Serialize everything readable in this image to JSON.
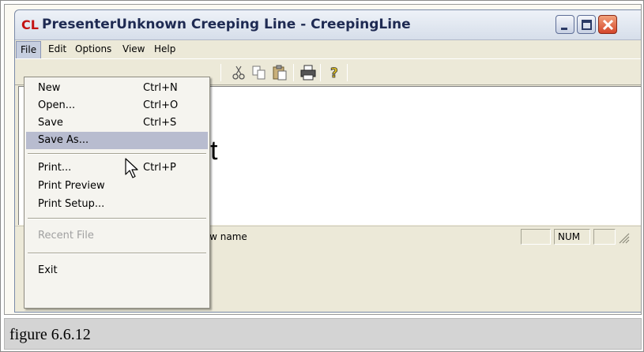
{
  "window": {
    "icon_text": "CL",
    "title": "PresenterUnknown Creeping Line - CreepingLine",
    "controls": {
      "minimize": "minimize",
      "maximize": "maximize",
      "close": "close"
    }
  },
  "menubar": {
    "items": [
      "File",
      "Edit",
      "Options",
      "View",
      "Help"
    ],
    "active": "File"
  },
  "toolbar": {
    "icons": [
      "cut-icon",
      "copy-icon",
      "paste-icon",
      "print-icon",
      "help-icon"
    ]
  },
  "content": {
    "partial_text": "xt"
  },
  "status_bar": {
    "message": "a new name",
    "num_indicator": "NUM"
  },
  "file_menu": {
    "items": [
      {
        "label": "New",
        "shortcut": "Ctrl+N"
      },
      {
        "label": "Open...",
        "shortcut": "Ctrl+O"
      },
      {
        "label": "Save",
        "shortcut": "Ctrl+S"
      },
      {
        "label": "Save As...",
        "shortcut": "",
        "selected": true
      },
      {
        "label": "Print...",
        "shortcut": "Ctrl+P"
      },
      {
        "label": "Print Preview",
        "shortcut": ""
      },
      {
        "label": "Print Setup...",
        "shortcut": ""
      },
      {
        "label": "Recent File",
        "shortcut": "",
        "disabled": true
      },
      {
        "label": "Exit",
        "shortcut": ""
      }
    ]
  },
  "caption": "figure 6.6.12"
}
